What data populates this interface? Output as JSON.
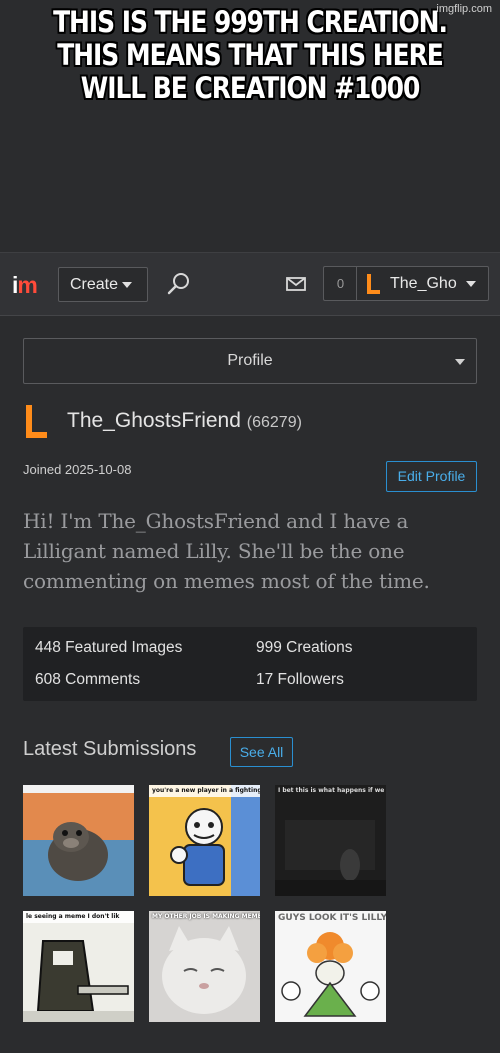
{
  "meme": {
    "caption": "THIS IS THE 999TH CREATION. THIS MEANS THAT THIS HERE WILL BE CREATION #1000",
    "watermark": "imgflip.com"
  },
  "navbar": {
    "logo_i": "i",
    "logo_m": "m",
    "create_label": "Create",
    "notification_count": "0",
    "username_short": "The_Gho"
  },
  "profile": {
    "section_select": "Profile",
    "username": "The_GhostsFriend",
    "points": "(66279)",
    "joined": "Joined 2025-10-08",
    "edit_label": "Edit Profile",
    "bio": "Hi! I'm The_GhostsFriend and I have a Lilligant named Lilly. She'll be the one commenting on memes most of the time.",
    "stats": {
      "featured": "448 Featured Images",
      "creations": "999 Creations",
      "comments": "608 Comments",
      "followers": "17 Followers"
    },
    "latest_title": "Latest Submissions",
    "see_all_label": "See All"
  },
  "thumbnails": [
    {
      "caption": "",
      "icon": "seal-photo"
    },
    {
      "caption": "you're a new player in a fighting",
      "icon": "sans-cartoon"
    },
    {
      "caption": "I bet this is what happens if we hit the whiteboard...",
      "icon": "dark-room"
    },
    {
      "caption": "le seeing a meme I don't lik",
      "icon": "suit-cartoon"
    },
    {
      "caption": "MY OTHER JOB IS MAKING MEMES ON IMGFLIP",
      "icon": "crying-cat"
    },
    {
      "caption": "GUYS LOOK IT'S LILLY!",
      "icon": "lilligant-cartoon"
    }
  ],
  "colors": {
    "background": "#2b2c2e",
    "accent_blue": "#2a8fd0",
    "user_icon_orange": "#ff8c1a",
    "logo_red": "#ff4b3a"
  }
}
